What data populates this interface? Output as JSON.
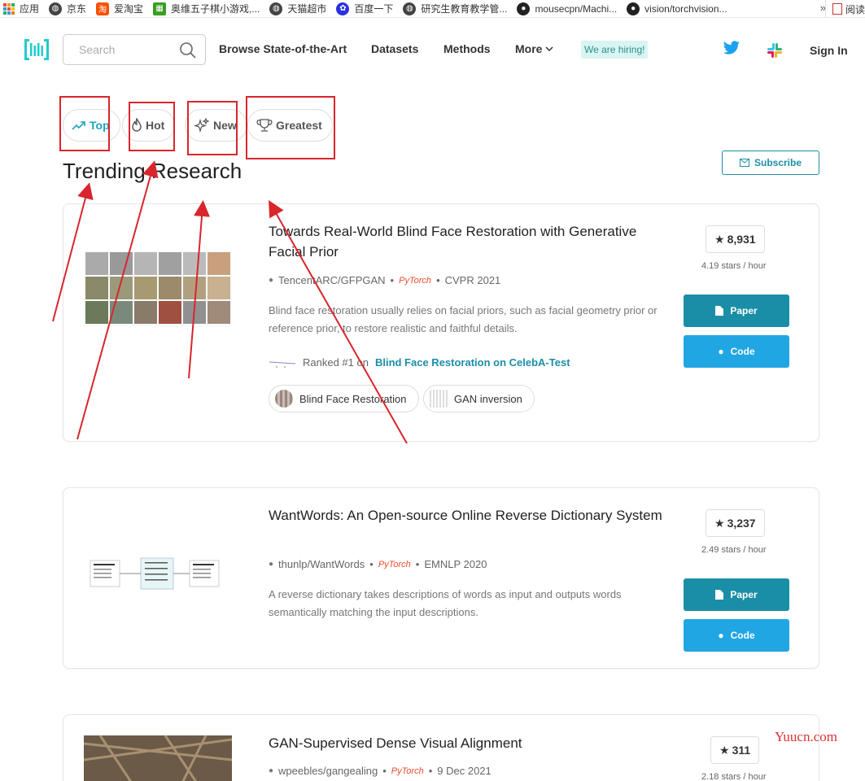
{
  "bookmarks": [
    {
      "label": "应用",
      "icon": "apps-grid-icon"
    },
    {
      "label": "京东",
      "icon": "globe-icon"
    },
    {
      "label": "爱淘宝",
      "icon": "taobao-icon"
    },
    {
      "label": "奥维五子棋小游戏,...",
      "icon": "game-icon"
    },
    {
      "label": "天猫超市",
      "icon": "globe-icon"
    },
    {
      "label": "百度一下",
      "icon": "baidu-paw-icon"
    },
    {
      "label": "研究生教育教学管...",
      "icon": "globe-icon"
    },
    {
      "label": "mousecpn/Machi...",
      "icon": "github-icon"
    },
    {
      "label": "vision/torchvision...",
      "icon": "github-icon"
    }
  ],
  "bookmarks_more": "»",
  "bookmarks_end": "阅读",
  "nav": {
    "search_placeholder": "Search",
    "links": [
      "Browse State-of-the-Art",
      "Datasets",
      "Methods",
      "More"
    ],
    "hiring": "We are hiring!",
    "sign_in": "Sign In"
  },
  "filters": [
    "Top",
    "Hot",
    "New",
    "Greatest"
  ],
  "heading": "Trending Research",
  "subscribe": "Subscribe",
  "papers": [
    {
      "title": "Towards Real-World Blind Face Restoration with Generative Facial Prior",
      "repo": "TencentARC/GFPGAN",
      "framework": "PyTorch",
      "venue": "CVPR 2021",
      "abstract": "Blind face restoration usually relies on facial priors, such as facial geometry prior or reference prior, to restore realistic and faithful details.",
      "ranked_prefix": "Ranked #1 on",
      "ranked_task": "Blind Face Restoration on CelebA-Test",
      "tags": [
        "Blind Face Restoration",
        "GAN inversion"
      ],
      "stars": "8,931",
      "rate": "4.19 stars / hour",
      "paper_btn": "Paper",
      "code_btn": "Code"
    },
    {
      "title": "WantWords: An Open-source Online Reverse Dictionary System",
      "repo": "thunlp/WantWords",
      "framework": "PyTorch",
      "venue": "EMNLP 2020",
      "abstract": "A reverse dictionary takes descriptions of words as input and outputs words semantically matching the input descriptions.",
      "stars": "3,237",
      "rate": "2.49 stars / hour",
      "paper_btn": "Paper",
      "code_btn": "Code"
    },
    {
      "title": "GAN-Supervised Dense Visual Alignment",
      "repo": "wpeebles/gangealing",
      "framework": "PyTorch",
      "venue": "9 Dec 2021",
      "stars": "311",
      "rate": "2.18 stars / hour"
    }
  ],
  "watermark": "Yuucn.com",
  "colors": {
    "accent": "#1b8ea7",
    "code": "#21a6e4",
    "annotation": "#d9262c"
  }
}
